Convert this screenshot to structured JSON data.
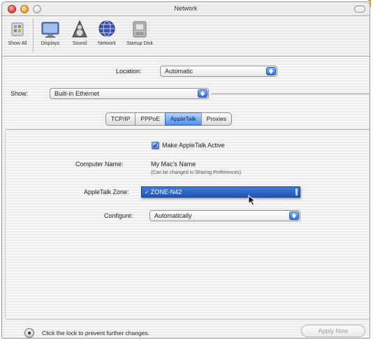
{
  "window": {
    "title": "Network"
  },
  "toolbar": {
    "items": [
      {
        "label": "Show All"
      },
      {
        "label": "Displays"
      },
      {
        "label": "Sound"
      },
      {
        "label": "Network"
      },
      {
        "label": "Startup Disk"
      }
    ]
  },
  "location": {
    "label": "Location:",
    "value": "Automatic"
  },
  "show": {
    "label": "Show:",
    "value": "Built-in Ethernet"
  },
  "tabs": [
    "TCP/IP",
    "PPPoE",
    "AppleTalk",
    "Proxies"
  ],
  "active_tab": "AppleTalk",
  "appletalk": {
    "make_active_label": "Make AppleTalk Active",
    "make_active_checked": true,
    "computer_name_label": "Computer Name:",
    "computer_name_value": "My Mac's Name",
    "computer_name_note": "(Can be changed in Sharing Preferences)",
    "zone_label": "AppleTalk Zone:",
    "zone_value": "ZONE-N42",
    "zone_check": "✓",
    "configure_label": "Configure:",
    "configure_value": "Automatically"
  },
  "footer": {
    "lock_text": "Click the lock to prevent further changes.",
    "apply_label": "Apply Now"
  },
  "colors": {
    "accent_blue": "#2a6fe0",
    "selection": "#2356b4",
    "window_stripe": "#ececec"
  },
  "icons": [
    "close-icon",
    "minimize-icon",
    "zoom-icon",
    "show-all-icon",
    "displays-icon",
    "sound-icon",
    "network-icon",
    "startup-disk-icon",
    "lock-icon",
    "cursor-arrow-icon"
  ]
}
